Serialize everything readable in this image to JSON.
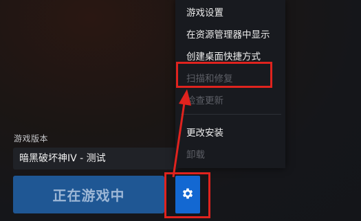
{
  "game_version": {
    "label": "游戏版本",
    "selected": "暗黑破坏神IV - 测试"
  },
  "play_button": {
    "label": "正在游戏中"
  },
  "settings_button": {
    "icon": "gear-icon"
  },
  "context_menu": {
    "items": [
      {
        "label": "游戏设置",
        "enabled": true
      },
      {
        "label": "在资源管理器中显示",
        "enabled": true
      },
      {
        "label": "创建桌面快捷方式",
        "enabled": true
      },
      {
        "label": "扫描和修复",
        "enabled": false
      },
      {
        "label": "检查更新",
        "enabled": false
      },
      {
        "label": "更改安装",
        "enabled": true
      },
      {
        "label": "卸载",
        "enabled": false
      }
    ]
  },
  "annotations": {
    "highlight_color": "#e0231e"
  },
  "colors": {
    "play_button_bg": "#1f5794",
    "settings_button_bg": "#1368d2",
    "menu_bg": "#181a1f"
  }
}
